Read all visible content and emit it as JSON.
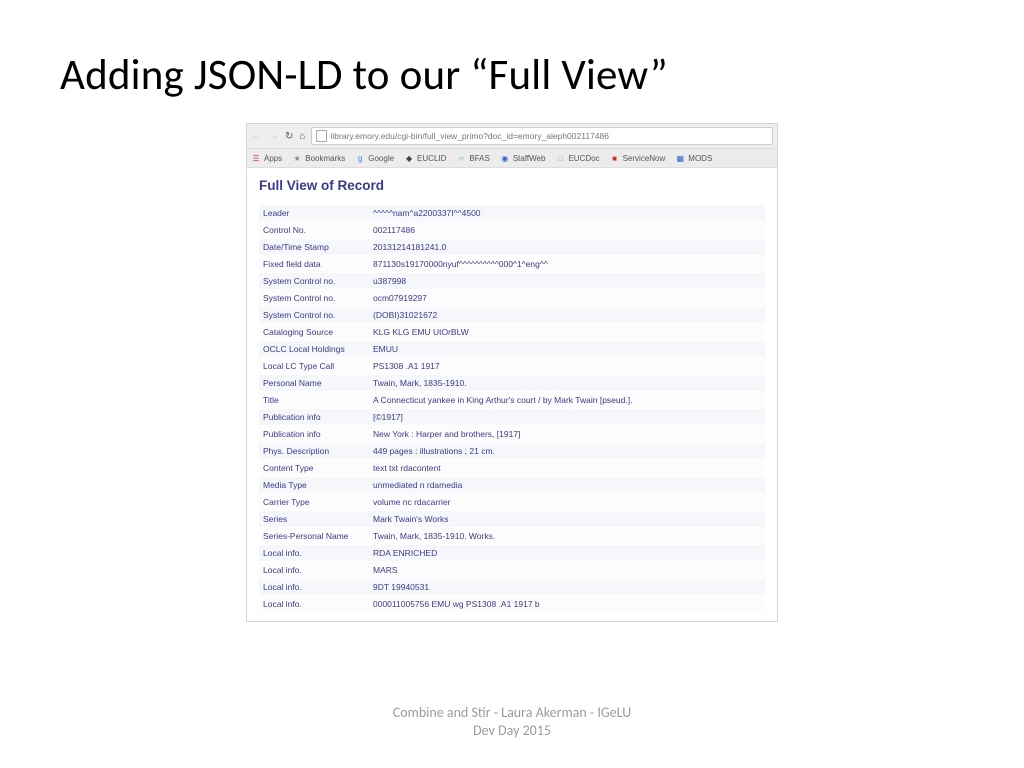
{
  "slide": {
    "title": "Adding JSON-LD to our “Full View”",
    "footer_line1": "Combine and Stir - Laura Akerman - IGeLU",
    "footer_line2": "Dev Day 2015"
  },
  "browser": {
    "url": "library.emory.edu/cgi-bin/full_view_primo?doc_id=emory_aleph002117486",
    "bookmarks": [
      {
        "label": "Apps",
        "icon": "☰",
        "color": "#d44"
      },
      {
        "label": "Bookmarks",
        "icon": "★",
        "color": "#888"
      },
      {
        "label": "Google",
        "icon": "g",
        "color": "#4285f4"
      },
      {
        "label": "EUCLID",
        "icon": "◆",
        "color": "#444"
      },
      {
        "label": "BFAS",
        "icon": "○",
        "color": "#2a8"
      },
      {
        "label": "StaffWeb",
        "icon": "◉",
        "color": "#36c"
      },
      {
        "label": "EUCDoc",
        "icon": "□",
        "color": "#999"
      },
      {
        "label": "ServiceNow",
        "icon": "■",
        "color": "#c33"
      },
      {
        "label": "MODS",
        "icon": "▦",
        "color": "#36c"
      }
    ]
  },
  "record": {
    "heading": "Full View of Record",
    "rows": [
      {
        "label": "Leader",
        "value": "^^^^^nam^a2200337I^^4500"
      },
      {
        "label": "Control No.",
        "value": "002117486"
      },
      {
        "label": "Date/Time Stamp",
        "value": "20131214181241.0"
      },
      {
        "label": "Fixed field data",
        "value": "871130s19170000nyuf^^^^^^^^^^000^1^eng^^"
      },
      {
        "label": "System Control no.",
        "value": "u387998"
      },
      {
        "label": "System Control no.",
        "value": "ocm07919297"
      },
      {
        "label": "System Control no.",
        "value": "(DOBI)31021672"
      },
      {
        "label": "Cataloging Source",
        "value": "KLG KLG EMU UtOrBLW"
      },
      {
        "label": "OCLC Local Holdings",
        "value": "EMUU"
      },
      {
        "label": "Local LC Type Call",
        "value": "PS1308 .A1 1917"
      },
      {
        "label": "Personal Name",
        "value": "Twain, Mark, 1835-1910."
      },
      {
        "label": "Title",
        "value": "A Connecticut yankee in King Arthur's court / by Mark Twain [pseud.]."
      },
      {
        "label": "Publication info",
        "value": "[©1917]"
      },
      {
        "label": "Publication info",
        "value": "New York : Harper and brothers, [1917]"
      },
      {
        "label": "Phys. Description",
        "value": "449 pages : illustrations ; 21 cm."
      },
      {
        "label": "Content Type",
        "value": "text txt rdacontent"
      },
      {
        "label": "Media Type",
        "value": "unmediated n rdamedia"
      },
      {
        "label": "Carrier Type",
        "value": "volume nc rdacarrier"
      },
      {
        "label": "Series",
        "value": "Mark Twain's Works"
      },
      {
        "label": "Series-Personal Name",
        "value": "Twain, Mark, 1835-1910. Works."
      },
      {
        "label": "Local info.",
        "value": "RDA ENRICHED"
      },
      {
        "label": "Local info.",
        "value": "MARS"
      },
      {
        "label": "Local info.",
        "value": "9DT 19940531"
      },
      {
        "label": "Local info.",
        "value": "000011005756 EMU wg PS1308 .A1 1917 b"
      }
    ]
  }
}
